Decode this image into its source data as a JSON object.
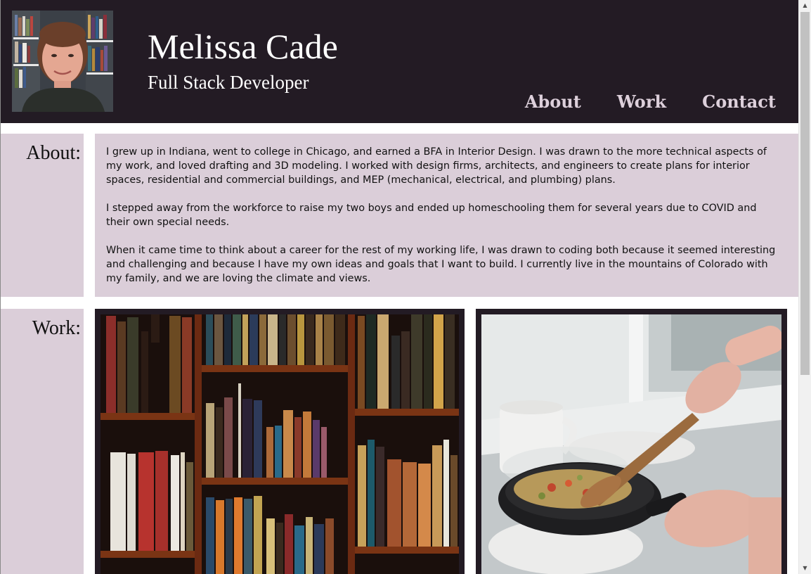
{
  "header": {
    "name": "Melissa Cade",
    "tagline": "Full Stack Developer",
    "portrait_alt": "Portrait of Melissa Cade in front of a bookshelf"
  },
  "nav": {
    "items": [
      {
        "label": "About"
      },
      {
        "label": "Work"
      },
      {
        "label": "Contact"
      }
    ]
  },
  "about": {
    "label": "About:",
    "paragraphs": [
      "I grew up in Indiana, went to college in Chicago, and earned a BFA in Interior Design. I was drawn to the more technical aspects of my work, and loved drafting and 3D modeling. I worked with design firms, architects, and engineers to create plans for interior spaces, residential and commercial buildings, and MEP (mechanical, electrical, and plumbing) plans.",
      "I stepped away from the workforce to raise my two boys and ended up homeschooling them for several years due to COVID and their own special needs.",
      "When it came time to think about a career for the rest of my working life, I was drawn to coding both because it seemed interesting and challenging and because I have my own ideas and goals that I want to build. I currently live in the mountains of Colorado with my family, and we are loving the climate and views."
    ]
  },
  "work": {
    "label": "Work:",
    "projects": [
      {
        "image_icon": "bookshelf-image"
      },
      {
        "image_icon": "cooking-pan-image"
      }
    ]
  },
  "colors": {
    "header_bg": "#231b24",
    "panel_bg": "#dbced9",
    "nav_text": "#ddd0db",
    "title_text": "#ffffff"
  }
}
